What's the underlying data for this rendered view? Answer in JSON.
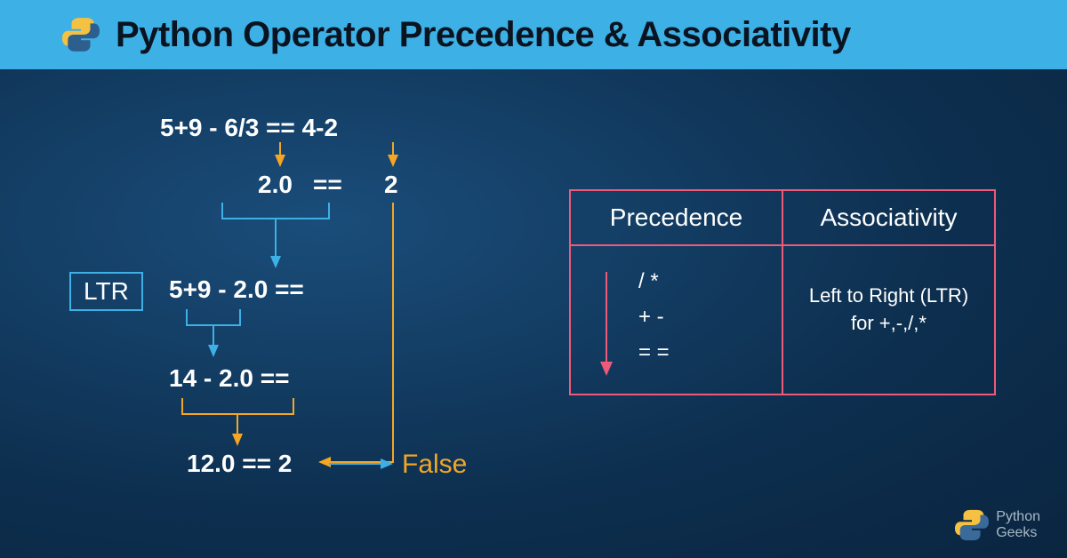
{
  "header": {
    "title": "Python Operator Precedence & Associativity"
  },
  "diagram": {
    "line1": "5+9 - 6/3 == 4-2",
    "line2_left": "2.0",
    "line2_mid": "==",
    "line2_right": "2",
    "ltr_label": "LTR",
    "line3": "5+9 - 2.0  ==",
    "line4": "14 - 2.0    ==",
    "line5": "12.0 == 2",
    "result": "False"
  },
  "table": {
    "col1_head": "Precedence",
    "col2_head": "Associativity",
    "precedence": [
      "/ *",
      "+ -",
      "= ="
    ],
    "associativity": "Left to Right (LTR) for +,-,/,*"
  },
  "footer": {
    "brand_line1": "Python",
    "brand_line2": "Geeks"
  },
  "chart_data": {
    "type": "table",
    "title": "Python Operator Precedence & Associativity",
    "precedence_order_high_to_low": [
      "/ *",
      "+ -",
      "=="
    ],
    "associativity": "Left to Right (LTR) for +, -, /, *",
    "evaluation_steps": [
      "5+9 - 6/3 == 4-2",
      "6/3 → 2.0, 4-2 → 2",
      "5+9 - 2.0 ==",
      "14 - 2.0 ==",
      "12.0 == 2",
      "False"
    ]
  }
}
